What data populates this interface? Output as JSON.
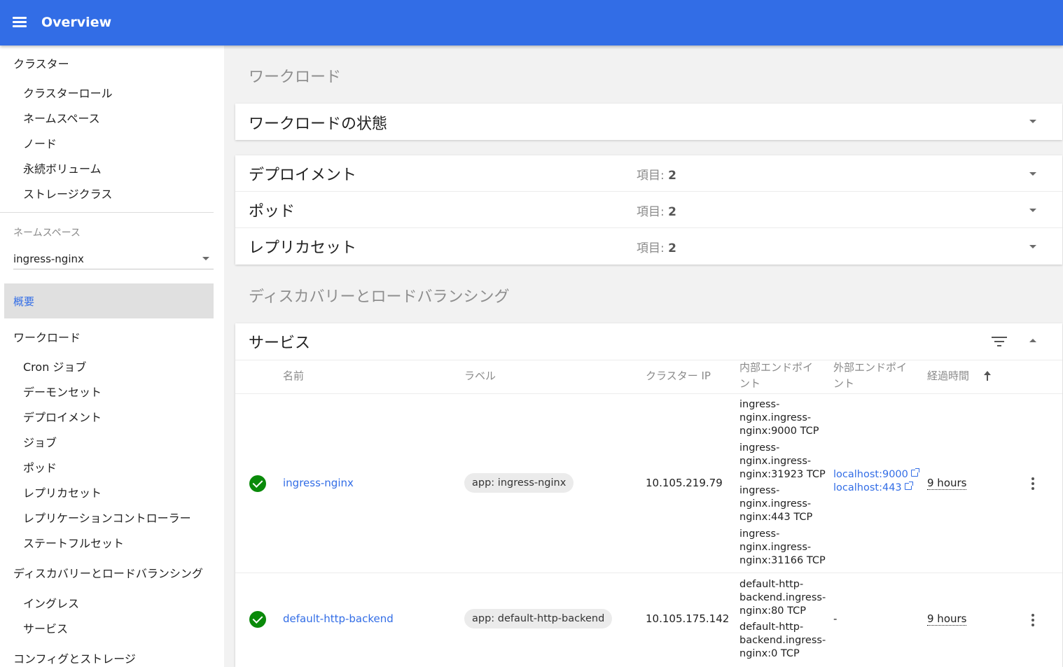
{
  "header": {
    "title": "Overview",
    "menu_icon": "menu-icon"
  },
  "sidebar": {
    "cluster": {
      "label": "クラスター",
      "items": [
        "クラスターロール",
        "ネームスペース",
        "ノード",
        "永続ボリューム",
        "ストレージクラス"
      ]
    },
    "namespace": {
      "caption": "ネームスペース",
      "selected": "ingress-nginx"
    },
    "overview_label": "概要",
    "workloads": {
      "label": "ワークロード",
      "items": [
        "Cron ジョブ",
        "デーモンセット",
        "デプロイメント",
        "ジョブ",
        "ポッド",
        "レプリカセット",
        "レプリケーションコントローラー",
        "ステートフルセット"
      ]
    },
    "discovery": {
      "label": "ディスカバリーとロードバランシング",
      "items": [
        "イングレス",
        "サービス"
      ]
    },
    "config_label": "コンフィグとストレージ"
  },
  "main": {
    "workloads_title": "ワークロード",
    "workload_status_title": "ワークロードの状態",
    "resources": [
      {
        "name": "デプロイメント",
        "count_label": "項目:",
        "count": "2"
      },
      {
        "name": "ポッド",
        "count_label": "項目:",
        "count": "2"
      },
      {
        "name": "レプリカセット",
        "count_label": "項目:",
        "count": "2"
      }
    ],
    "discovery_title": "ディスカバリーとロードバランシング",
    "services": {
      "title": "サービス",
      "columns": {
        "name": "名前",
        "labels": "ラベル",
        "cluster_ip": "クラスター IP",
        "internal_endpoints_1": "内部エンドポイ",
        "internal_endpoints_2": "ント",
        "external_endpoints_1": "外部エンドポイ",
        "external_endpoints_2": "ント",
        "age": "経過時間"
      },
      "rows": [
        {
          "status": "ok",
          "name": "ingress-nginx",
          "label": "app: ingress-nginx",
          "cluster_ip": "10.105.219.79",
          "internal_endpoints": [
            [
              "ingress-",
              "nginx.ingress-",
              "nginx:9000 TCP"
            ],
            [
              "ingress-",
              "nginx.ingress-",
              "nginx:31923 TCP"
            ],
            [
              "ingress-",
              "nginx.ingress-",
              "nginx:443 TCP"
            ],
            [
              "ingress-",
              "nginx.ingress-",
              "nginx:31166 TCP"
            ]
          ],
          "external_endpoints": [
            "localhost:9000",
            "localhost:443"
          ],
          "age": "9 hours"
        },
        {
          "status": "ok",
          "name": "default-http-backend",
          "label": "app: default-http-backend",
          "cluster_ip": "10.105.175.142",
          "internal_endpoints": [
            [
              "default-http-",
              "backend.ingress-",
              "nginx:80 TCP"
            ],
            [
              "default-http-",
              "backend.ingress-",
              "nginx:0 TCP"
            ]
          ],
          "external_endpoints_text": "-",
          "age": "9 hours"
        }
      ]
    }
  },
  "colors": {
    "primary": "#326de6",
    "success": "#0a8a0a"
  }
}
